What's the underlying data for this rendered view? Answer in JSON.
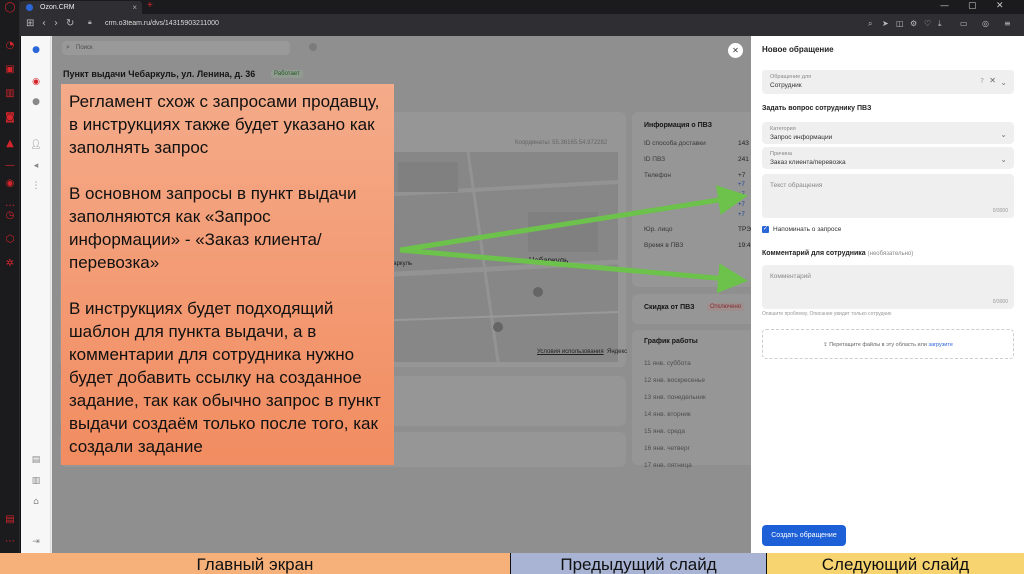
{
  "browser": {
    "tab_title": "Ozon.CRM",
    "url": "crm.o3team.ru/dvs/14315903211000"
  },
  "app": {
    "search_placeholder": "Поиск",
    "pvz_title": "Пункт выдачи Чебаркуль, ул. Ленина, д. 36",
    "pvz_status": "Работает",
    "map": {
      "coords": "Координаты: 55.36165,54.972282",
      "street": "елебинская, Чебаркуль",
      "city": "Чебаркуль",
      "terms": "Условия использования",
      "brand": "Яндекс"
    },
    "info": {
      "title": "Информация о ПВЗ",
      "rows": [
        {
          "label": "ID способа доставки",
          "value": "143"
        },
        {
          "label": "ID ПВЗ",
          "value": "241"
        },
        {
          "label": "Телефон",
          "value": "+7"
        },
        {
          "label": "Юр. лицо",
          "value": "ТРЭ"
        },
        {
          "label": "Время в ПВЗ",
          "value": "19:4"
        }
      ],
      "phones": [
        "+7",
        "+7",
        "+7",
        "+7"
      ]
    },
    "discount": {
      "title": "Скидка от ПВЗ",
      "badge": "Отключено"
    },
    "schedule": {
      "title": "График работы",
      "days": [
        "11 янв. суббота",
        "12 янв. воскресенье",
        "13 янв. понедельник",
        "14 янв. вторник",
        "15 янв. среда",
        "16 янв. четверг",
        "17 янв. пятница"
      ]
    }
  },
  "drawer": {
    "title": "Новое обращение",
    "appeal_for": {
      "label": "Обращение для",
      "value": "Сотрудник"
    },
    "section_ask": "Задать вопрос сотруднику ПВЗ",
    "category": {
      "label": "Категория",
      "value": "Запрос информации"
    },
    "reason": {
      "label": "Причина",
      "value": "Заказ клиента/перевозка"
    },
    "text_placeholder": "Текст обращения",
    "counter1": "0/3000",
    "remind_label": "Напоминать о запросе",
    "section_comment": "Комментарий для сотрудника",
    "section_comment_optional": "(необязательно)",
    "comment_placeholder": "Комментарий",
    "counter2": "0/3000",
    "comment_hint": "Опишите проблему. Описание увидит только сотрудник",
    "dropzone_text": "Перетащите файлы в эту область или",
    "dropzone_link": "загрузите",
    "submit": "Создать обращение"
  },
  "slide_note": {
    "paragraphs": [
      "Регламент схож с запросами продавцу, в инструкциях также будет указано как заполнять запрос",
      "В основном запросы в пункт выдачи заполняются как «Запрос информации» - «Заказ клиента/перевозка»",
      "В инструкциях будет подходящий шаблон для пункта выдачи, а в комментарии для сотрудника нужно будет добавить ссылку на созданное задание, так как обычно запрос в пункт выдачи создаём только после того, как создали задание"
    ]
  },
  "slide_nav": {
    "home": "Главный экран",
    "prev": "Предыдущий слайд",
    "next": "Следующий слайд"
  },
  "colors": {
    "arrow": "#6cc24a",
    "note_bg": "#f4a07a",
    "submit": "#1c5fd6",
    "opera_red": "#d3242b"
  },
  "icons": [
    "search-icon",
    "lock-icon",
    "close-icon",
    "chevron-down-icon",
    "help-icon",
    "upload-icon",
    "home-icon"
  ]
}
